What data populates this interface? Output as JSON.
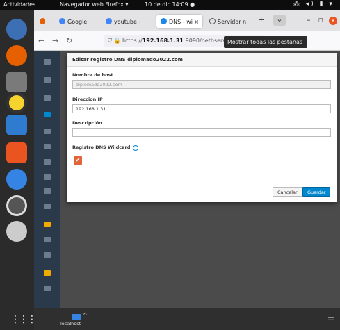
{
  "topbar": {
    "activities": "Actividades",
    "app_menu": "Navegador web Firefox ▾",
    "clock": "10 de dic  14:09  ●",
    "system": "⁂ ◂) ▮ ▾"
  },
  "browser": {
    "tabs": [
      {
        "label": "Google",
        "icon": "google-icon",
        "color": "#4285f4"
      },
      {
        "label": "youtube - ",
        "icon": "google-icon",
        "color": "#4285f4"
      },
      {
        "label": "DNS - wi ×",
        "icon": "nethserver-icon",
        "color": "#1e88e5"
      },
      {
        "label": "Servidor n",
        "icon": "info-icon",
        "color": "#555555"
      }
    ],
    "new_tab": "+",
    "tab_list": "⌄",
    "url_prefix": "https://",
    "url_host": "192.168.1.31",
    "url_rest": ":9090/nethserver#/dns",
    "tooltip": "Mostrar todas las pestañas"
  },
  "dialog": {
    "title": "Editar registro DNS diplomado2022.com",
    "hostname_label": "Nombre de host",
    "hostname_value": "diplomado2022.com",
    "ip_label": "Direccion IP",
    "ip_value": "192.168.1.31",
    "description_label": "Descripción",
    "description_value": "",
    "wildcard_label": "Registro DNS Wildcard",
    "wildcard_checked": "✔",
    "cancel_label": "Cancelar",
    "save_label": "Guardar"
  },
  "taskbar": {
    "window_label": "localhost",
    "menu": "☰",
    "apps": "⋮⋮⋮"
  },
  "colors": {
    "accent_blue": "#0088ce",
    "checkbox": "#e0653a"
  }
}
